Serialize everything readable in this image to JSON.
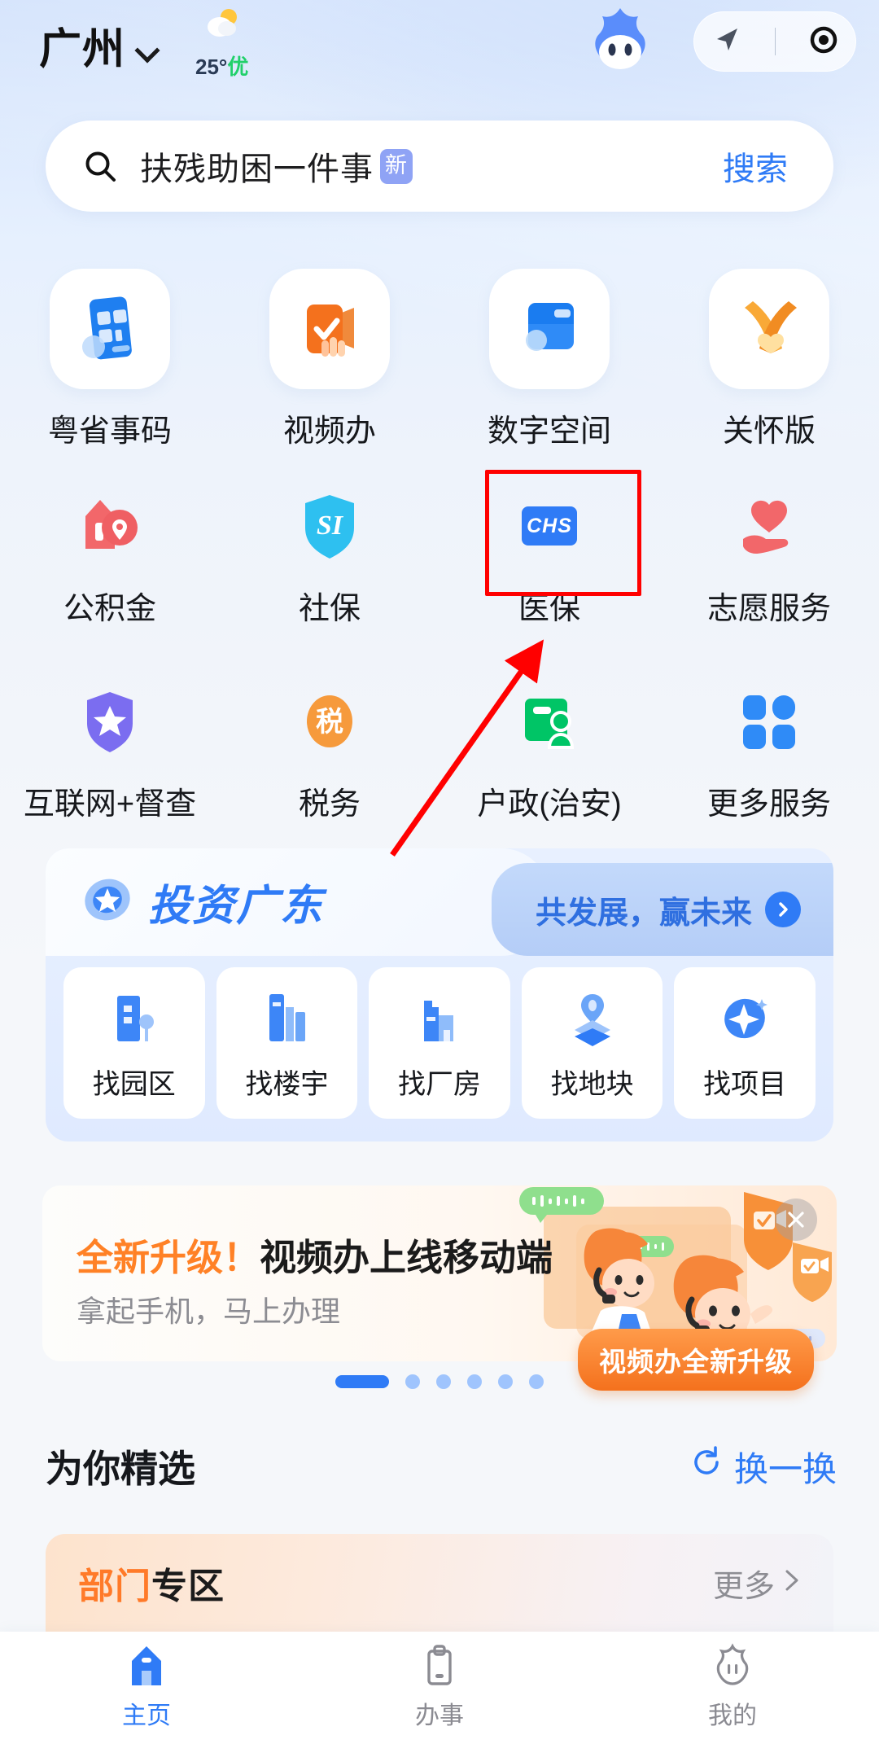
{
  "header": {
    "city": "广州",
    "chevron_icon": "chevron-down-icon",
    "weather": {
      "icon": "sun-behind-cloud-icon",
      "temp": "25°",
      "aqi": "优"
    },
    "mascot_icon": "mascot-icon",
    "capsule": {
      "location_icon": "navigation-arrow-icon",
      "target_icon": "target-circle-icon"
    }
  },
  "search": {
    "icon": "search-icon",
    "keyword": "扶残助困一件事",
    "badge": "新",
    "button": "搜索"
  },
  "quick_grid": {
    "row1": [
      {
        "label": "粤省事码",
        "icon": "qr-card-icon"
      },
      {
        "label": "视频办",
        "icon": "video-check-icon"
      },
      {
        "label": "数字空间",
        "icon": "blue-folder-icon"
      },
      {
        "label": "关怀版",
        "icon": "orange-ribbon-icon"
      }
    ],
    "row2": [
      {
        "label": "公积金",
        "icon": "house-pin-icon"
      },
      {
        "label": "社保",
        "icon": "si-shield-icon",
        "icon_text": "SI"
      },
      {
        "label": "医保",
        "icon": "chs-card-icon",
        "icon_text": "CHS",
        "highlighted": true
      },
      {
        "label": "志愿服务",
        "icon": "heart-hand-icon"
      }
    ],
    "row3": [
      {
        "label": "互联网+督查",
        "icon": "purple-star-shield-icon"
      },
      {
        "label": "税务",
        "icon": "tax-circle-icon",
        "icon_text": "税"
      },
      {
        "label": "户政(治安)",
        "icon": "green-id-card-icon"
      },
      {
        "label": "更多服务",
        "icon": "grid-more-icon"
      }
    ]
  },
  "invest": {
    "logo_icon": "invest-logo-icon",
    "title": "投资广东",
    "cta": "共发展，赢未来",
    "cta_arrow_icon": "chevron-right-circle-icon",
    "items": [
      {
        "label": "找园区",
        "icon": "park-building-icon"
      },
      {
        "label": "找楼宇",
        "icon": "office-tower-icon"
      },
      {
        "label": "找厂房",
        "icon": "factory-icon"
      },
      {
        "label": "找地块",
        "icon": "land-pin-icon"
      },
      {
        "label": "找项目",
        "icon": "project-sparkle-icon"
      }
    ]
  },
  "promo": {
    "title_highlight": "全新升级！",
    "title_rest": "视频办上线移动端",
    "subtitle": "拿起手机，马上办理",
    "badge": "视频办全新升级",
    "close_icon": "close-icon",
    "art_icon": "video-service-agents-illustration"
  },
  "carousel": {
    "total": 6,
    "active_index": 0
  },
  "for_you": {
    "title": "为你精选",
    "refresh_icon": "refresh-icon",
    "refresh_label": "换一换"
  },
  "dept_card": {
    "title_orange": "部门",
    "title_black": "专区",
    "more": "更多",
    "more_icon": "chevron-right-icon"
  },
  "tabbar": [
    {
      "label": "主页",
      "icon": "home-icon",
      "active": true
    },
    {
      "label": "办事",
      "icon": "clipboard-icon",
      "active": false
    },
    {
      "label": "我的",
      "icon": "profile-mascot-icon",
      "active": false
    }
  ],
  "annotation": {
    "box_color": "#ff0000",
    "arrow_color": "#ff0000",
    "target": "医保"
  }
}
